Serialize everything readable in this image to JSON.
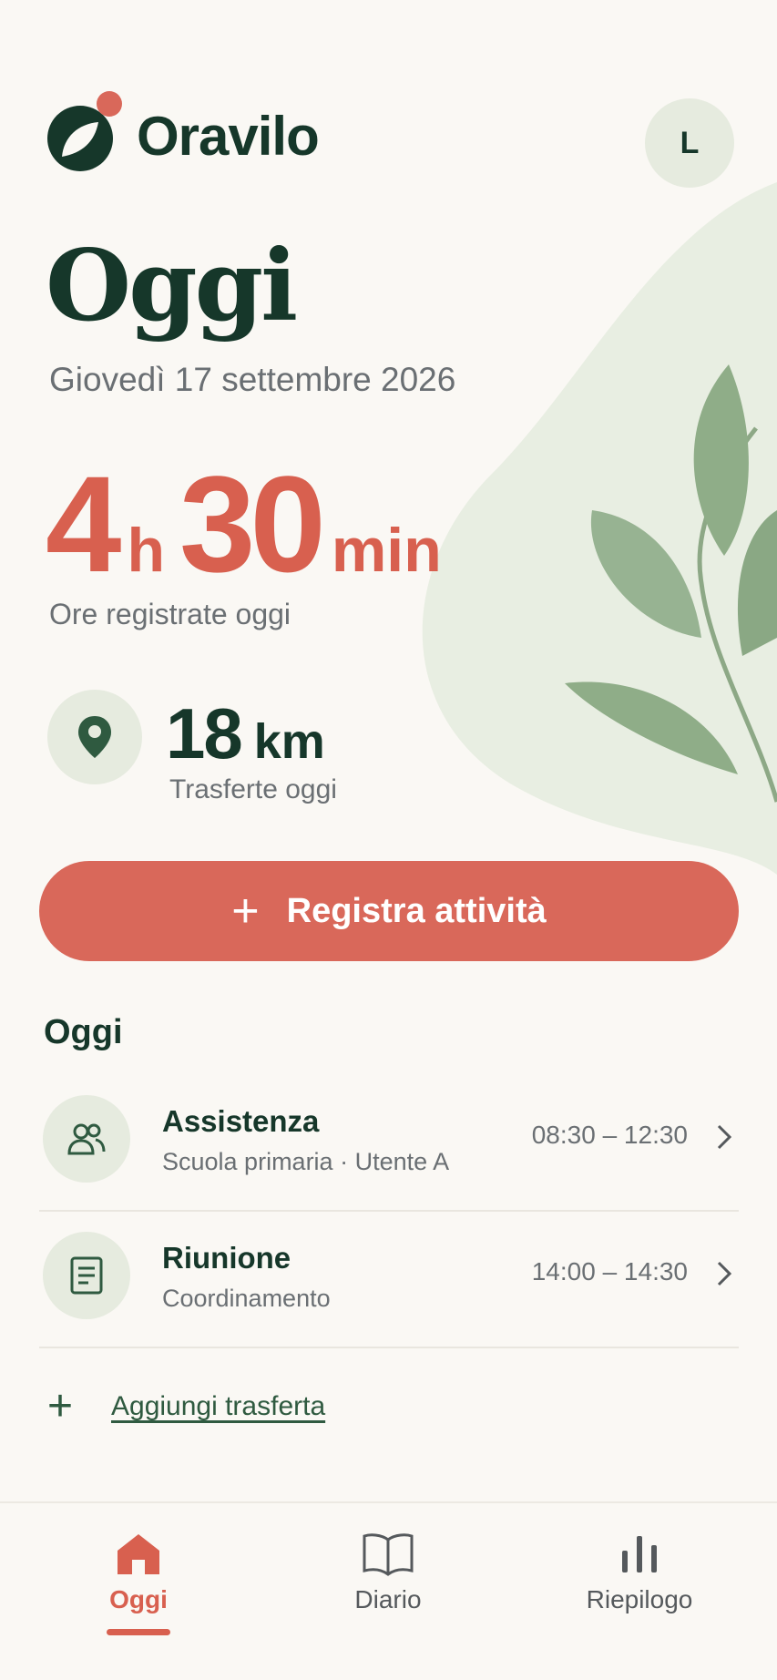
{
  "app": {
    "name": "Oravilo"
  },
  "user": {
    "initial": "L"
  },
  "page": {
    "title": "Oggi",
    "date": "Giovedì 17 settembre 2026"
  },
  "summary": {
    "hours_value": "4",
    "hours_unit": "h",
    "minutes_value": "30",
    "minutes_unit": "min",
    "hours_label": "Ore registrate oggi",
    "distance_value": "18",
    "distance_unit": "km",
    "distance_label": "Trasferte oggi",
    "distance_icon": "map-pin-icon"
  },
  "actions": {
    "register_label": "Registra attività",
    "add_trip_label": "Aggiungi trasferta"
  },
  "today": {
    "section_title": "Oggi",
    "items": [
      {
        "title": "Assistenza",
        "subtitle": "Scuola primaria · Utente A",
        "time": "08:30 – 12:30",
        "icon": "users-icon"
      },
      {
        "title": "Riunione",
        "subtitle": "Coordinamento",
        "time": "14:00 – 14:30",
        "icon": "document-icon"
      }
    ]
  },
  "tabs": [
    {
      "label": "Oggi",
      "icon": "home-icon",
      "active": true
    },
    {
      "label": "Diario",
      "icon": "book-icon",
      "active": false
    },
    {
      "label": "Riepilogo",
      "icon": "bar-chart-icon",
      "active": false
    }
  ],
  "colors": {
    "primary": "#d9685a",
    "accent": "#d8604f",
    "dark_green": "#16372a",
    "sage": "#e6ebdf"
  }
}
